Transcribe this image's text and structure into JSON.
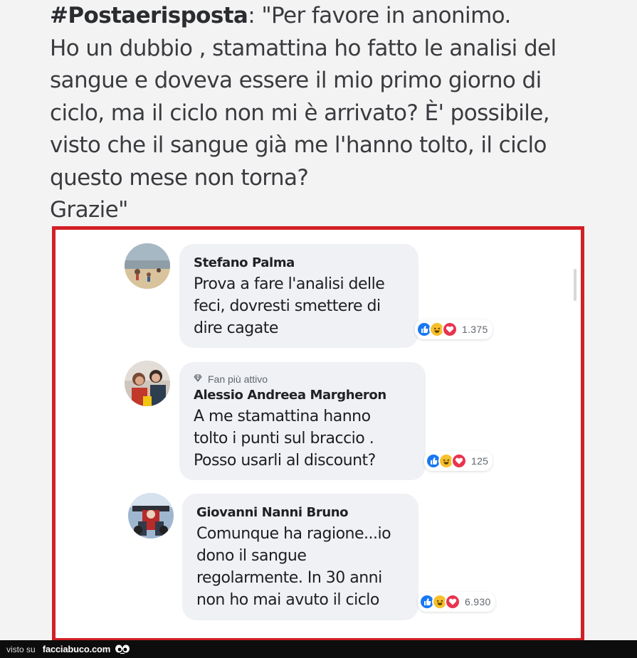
{
  "post": {
    "hashtag": "#Postaerisposta",
    "line1_rest": ": \"Per favore in anonimo.",
    "lines": [
      "Ho un dubbio , stamattina ho fatto le analisi del",
      "sangue e doveva essere il mio primo giorno di",
      "ciclo, ma il ciclo non mi è arrivato? È' possibile,",
      "visto che il sangue già me l'hanno tolto, il ciclo",
      "questo mese non torna?",
      "Grazie\""
    ]
  },
  "comments": [
    {
      "author": "Stefano Palma",
      "badge": "",
      "lines": [
        "Prova a fare l'analisi delle",
        "feci, dovresti smettere di",
        "dire cagate"
      ],
      "reactions": [
        "like",
        "haha",
        "love"
      ],
      "reaction_count": "1.375"
    },
    {
      "author": "Alessio Andreea Margheron",
      "badge": "Fan più attivo",
      "lines": [
        "A me stamattina hanno",
        "tolto i punti sul braccio .",
        "Posso usarli al discount?"
      ],
      "reactions": [
        "like",
        "haha",
        "love"
      ],
      "reaction_count": "125"
    },
    {
      "author": "Giovanni Nanni Bruno",
      "badge": "",
      "lines": [
        "Comunque ha ragione...io",
        "dono il sangue",
        "regolarmente. In 30 anni",
        "non ho mai avuto il ciclo"
      ],
      "reactions": [
        "like",
        "haha",
        "love"
      ],
      "reaction_count": "6.930"
    }
  ],
  "footer": {
    "prefix": "visto su",
    "brand": "facciabuco.com"
  },
  "colors": {
    "highlight_border": "#d31f26",
    "like": "#1877f2",
    "haha": "#f7c02d",
    "love": "#e8344e",
    "bubble": "#f0f1f4"
  },
  "icons": {
    "badge": "diamond-icon",
    "like": "thumbs-up-icon",
    "haha": "laughing-face-icon",
    "love": "heart-icon",
    "footer_logo": "eyes-icon"
  }
}
